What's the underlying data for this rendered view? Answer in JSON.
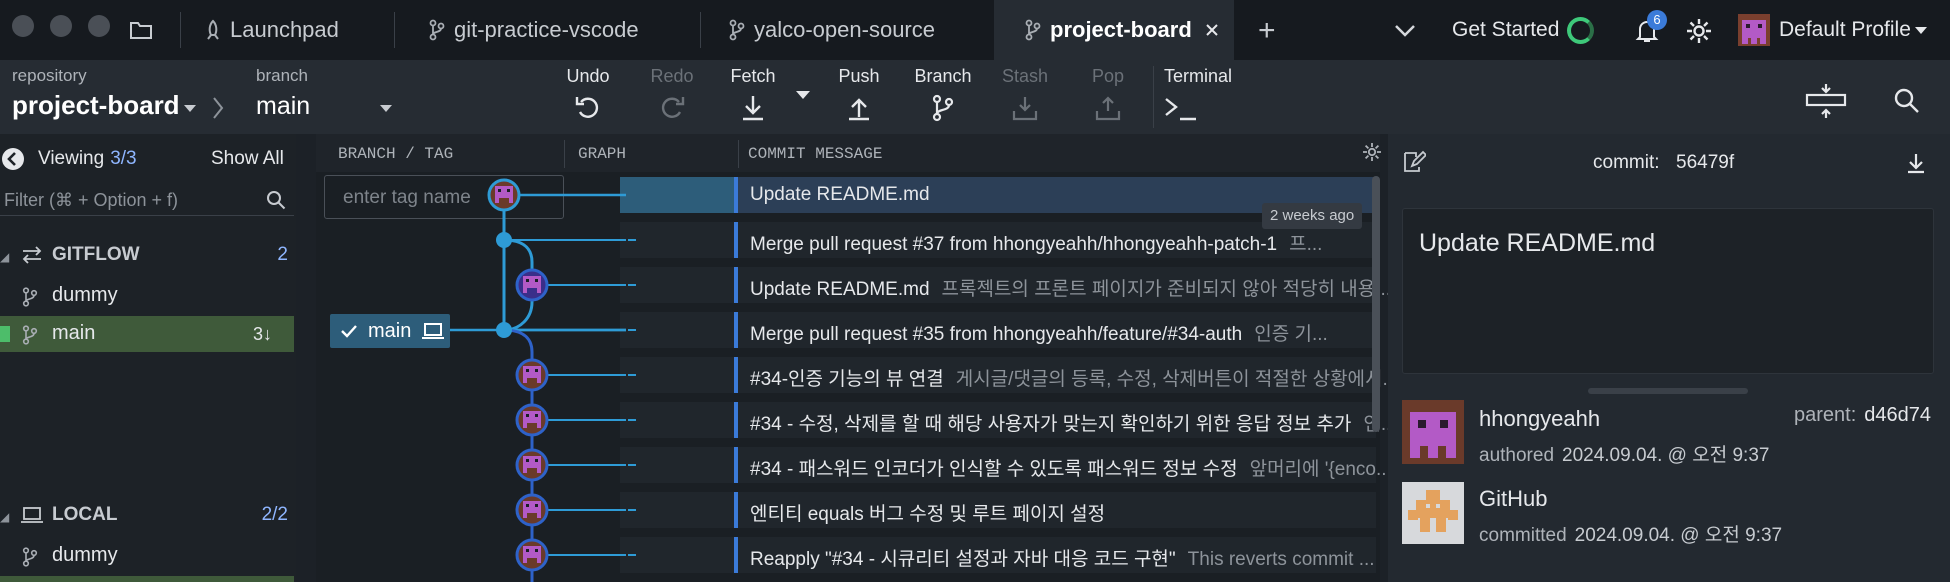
{
  "tabs": {
    "launchpad": "Launchpad",
    "repo1": "git-practice-vscode",
    "repo2": "yalco-open-source",
    "active": "project-board"
  },
  "topbar": {
    "get_started": "Get Started",
    "notifications_count": "6",
    "profile_name": "Default Profile"
  },
  "toolbar": {
    "repository_label": "repository",
    "repository_name": "project-board",
    "branch_label": "branch",
    "branch_name": "main",
    "undo": "Undo",
    "redo": "Redo",
    "fetch": "Fetch",
    "push": "Push",
    "branch": "Branch",
    "stash": "Stash",
    "pop": "Pop",
    "terminal": "Terminal"
  },
  "sidebar": {
    "viewing_label": "Viewing",
    "viewing_count": "3/3",
    "show_all": "Show All",
    "filter_placeholder": "Filter (⌘ + Option + f)",
    "gitflow": {
      "title": "GITFLOW",
      "count": "2"
    },
    "gitflow_items": [
      {
        "label": "dummy",
        "right": ""
      },
      {
        "label": "main",
        "right": "3↓"
      }
    ],
    "local": {
      "title": "LOCAL",
      "count": "2/2"
    },
    "local_items": [
      {
        "label": "dummy"
      }
    ]
  },
  "graph": {
    "col_branch": "BRANCH / TAG",
    "col_graph": "GRAPH",
    "col_message": "COMMIT MESSAGE",
    "tag_placeholder": "enter tag name",
    "main_label": "main",
    "time_badge": "2 weeks ago",
    "rows": [
      {
        "msg": "Update README.md",
        "desc": ""
      },
      {
        "msg": "Merge pull request #37 from hhongyeahh/hhongyeahh-patch-1",
        "desc": "프..."
      },
      {
        "msg": "Update README.md",
        "desc": "프록젝트의 프론트 페이지가 준비되지 않아 적당히 내용..."
      },
      {
        "msg": "Merge pull request #35 from hhongyeahh/feature/#34-auth",
        "desc": "인증 기..."
      },
      {
        "msg": "#34-인증 기능의 뷰 연결",
        "desc": "게시글/댓글의 등록, 수정, 삭제버튼이 적절한 상황에서..."
      },
      {
        "msg": "#34 - 수정, 삭제를 할 때 해당 사용자가 맞는지 확인하기 위한 응답 정보 추가",
        "desc": "인..."
      },
      {
        "msg": "#34 - 패스워드 인코더가 인식할 수 있도록 패스워드 정보 수정",
        "desc": "앞머리에 '{enco..."
      },
      {
        "msg": "엔티티 equals 버그 수정 및 루트 페이지 설정",
        "desc": ""
      },
      {
        "msg": "Reapply \"#34 - 시큐리티 설정과 자바 대응 코드 구현\"",
        "desc": "This reverts commit ..."
      }
    ]
  },
  "details": {
    "commit_label": "commit:",
    "commit_id": "56479f",
    "message": "Update README.md",
    "author": "hhongyeahh",
    "parent_label": "parent:",
    "parent_id": "d46d74",
    "authored_label": "authored",
    "authored_date": "2024.09.04. @ 오전 9:37",
    "committer": "GitHub",
    "committed_label": "committed",
    "committed_date": "2024.09.04. @ 오전 9:37"
  },
  "colors": {
    "accent_blue": "#3b7bd9",
    "graph_line": "#2e9bd6",
    "selected_branch": "#3f5a3a",
    "progress_green": "#3ec97a"
  }
}
